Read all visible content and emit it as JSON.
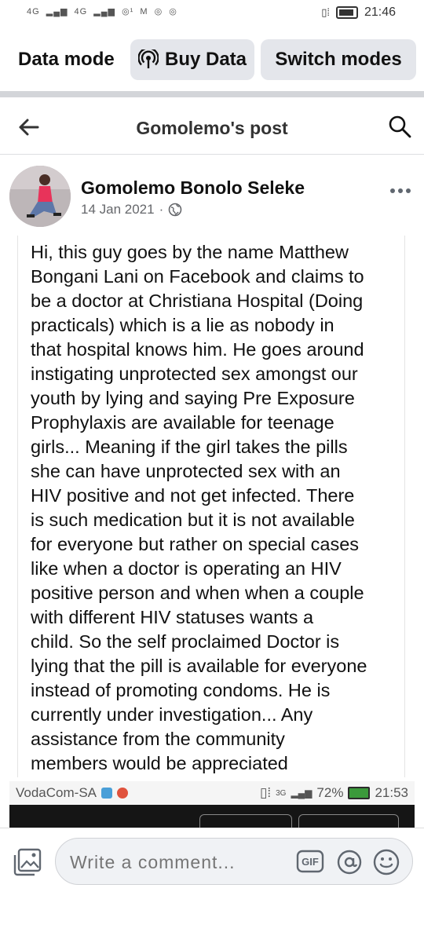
{
  "status_bar": {
    "left_indicators": [
      "4G",
      "4G",
      "◎¹",
      "M",
      "◎",
      "◎"
    ],
    "time": "21:46"
  },
  "data_mode_bar": {
    "title": "Data mode",
    "buy_data_label": "Buy Data",
    "switch_modes_label": "Switch modes"
  },
  "post_header": {
    "title": "Gomolemo's post"
  },
  "post": {
    "author": "Gomolemo Bonolo Seleke",
    "date": "14 Jan 2021",
    "separator": "·",
    "text": "Hi, this guy goes by the name Matthew\nBongani Lani on Facebook and claims to\nbe a doctor at Christiana Hospital (Doing\npracticals) which is a lie as nobody in\nthat hospital knows him. He goes around\ninstigating unprotected sex amongst our\nyouth by lying and saying Pre Exposure\nProphylaxis are available for teenage\ngirls... Meaning if the girl takes the pills\nshe can have unprotected sex with an\nHIV positive and not get infected. There\nis such medication but it is not available\nfor everyone but rather on special cases\nlike when a doctor is operating an HIV\npositive person and when when a couple\nwith different HIV statuses wants a\nchild. So the self proclaimed Doctor is\nlying that the pill is available for everyone\ninstead of promoting condoms. He is\ncurrently under investigation... Any\nassistance from the community\nmembers would be appreciated"
  },
  "inner_screenshot_status": {
    "carrier": "VodaCom-SA",
    "network": "3G",
    "battery": "72%",
    "time": "21:53"
  },
  "comment_bar": {
    "placeholder": "Write a comment...",
    "gif_label": "GIF"
  },
  "colors": {
    "pill_bg": "#e4e6eb",
    "divider": "#d3d5d9",
    "muted_text": "#65676b"
  }
}
